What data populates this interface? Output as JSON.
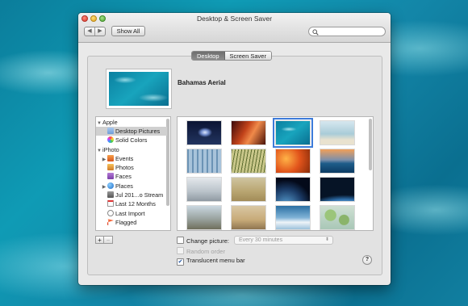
{
  "window": {
    "title": "Desktop & Screen Saver"
  },
  "toolbar": {
    "back": "◀",
    "forward": "▶",
    "show_all": "Show All",
    "search_placeholder": ""
  },
  "tabs": [
    {
      "label": "Desktop",
      "active": true
    },
    {
      "label": "Screen Saver",
      "active": false
    }
  ],
  "preview": {
    "label": "Bahamas Aerial"
  },
  "sidebar": {
    "items": [
      {
        "label": "Apple",
        "indent": 0,
        "disclosure": "▼",
        "icon": ""
      },
      {
        "label": "Desktop Pictures",
        "indent": 1,
        "icon": "folder-icon",
        "selected": true
      },
      {
        "label": "Solid Colors",
        "indent": 1,
        "icon": "color-wheel-icon"
      },
      {
        "label": "iPhoto",
        "indent": 0,
        "disclosure": "▼",
        "icon": ""
      },
      {
        "label": "Events",
        "indent": 1,
        "disclosure": "▶",
        "icon": "events-icon"
      },
      {
        "label": "Photos",
        "indent": 1,
        "icon": "photos-icon"
      },
      {
        "label": "Faces",
        "indent": 1,
        "icon": "faces-icon"
      },
      {
        "label": "Places",
        "indent": 1,
        "disclosure": "▶",
        "icon": "globe-icon"
      },
      {
        "label": "Jul 201...o Stream",
        "indent": 1,
        "icon": "photo-stream-icon"
      },
      {
        "label": "Last 12 Months",
        "indent": 1,
        "icon": "calendar-icon"
      },
      {
        "label": "Last Import",
        "indent": 1,
        "icon": "clock-icon"
      },
      {
        "label": "Flagged",
        "indent": 1,
        "icon": "flag-icon"
      }
    ]
  },
  "buttons": {
    "add": "+",
    "remove": "−",
    "help": "?"
  },
  "options": {
    "change_picture": "Change picture:",
    "change_picture_checked": false,
    "interval": "Every 30 minutes",
    "random_order": "Random order",
    "translucent_menu_bar": "Translucent menu bar",
    "translucent_checked": true
  },
  "thumbnails": [
    {
      "name": "galaxy",
      "selected": false
    },
    {
      "name": "red-rock",
      "selected": false
    },
    {
      "name": "bahamas-aerial",
      "selected": true
    },
    {
      "name": "beach-sky",
      "selected": false
    },
    {
      "name": "foggy-forest",
      "selected": false
    },
    {
      "name": "grass",
      "selected": false
    },
    {
      "name": "autumn-leaves",
      "selected": false
    },
    {
      "name": "ocean-horizon",
      "selected": false
    },
    {
      "name": "misty-trees",
      "selected": false
    },
    {
      "name": "bird-dusk",
      "selected": false
    },
    {
      "name": "planet-moon",
      "selected": false
    },
    {
      "name": "earth-horizon",
      "selected": false
    },
    {
      "name": "elephant",
      "selected": false
    },
    {
      "name": "zebras",
      "selected": false
    },
    {
      "name": "ice-water",
      "selected": false
    },
    {
      "name": "lily-pads",
      "selected": false
    },
    {
      "name": "partial-1",
      "selected": false
    },
    {
      "name": "partial-2",
      "selected": false
    },
    {
      "name": "partial-3",
      "selected": false
    },
    {
      "name": "partial-4",
      "selected": false
    }
  ]
}
